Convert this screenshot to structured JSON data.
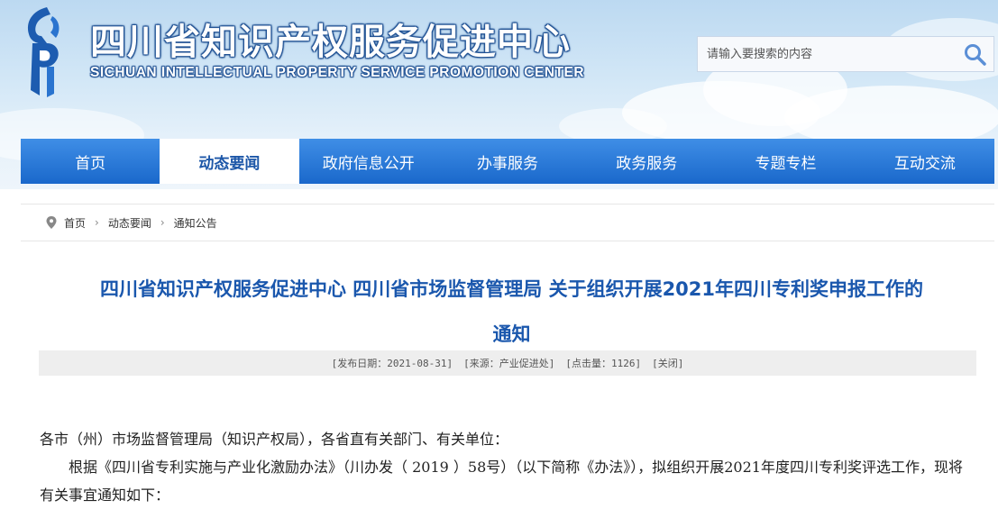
{
  "header": {
    "title": "四川省知识产权服务促进中心",
    "subtitle": "SICHUAN INTELLECTUAL PROPERTY SERVICE PROMOTION CENTER",
    "search": {
      "placeholder": "请输入要搜索的内容",
      "icon": "search-icon"
    }
  },
  "nav": {
    "items": [
      {
        "label": "首页"
      },
      {
        "label": "动态要闻",
        "active": true
      },
      {
        "label": "政府信息公开"
      },
      {
        "label": "办事服务"
      },
      {
        "label": "政务服务"
      },
      {
        "label": "专题专栏"
      },
      {
        "label": "互动交流"
      }
    ]
  },
  "breadcrumb": {
    "icon": "location-pin-icon",
    "items": [
      "首页",
      "动态要闻",
      "通知公告"
    ]
  },
  "article": {
    "title_line1": "四川省知识产权服务促进中心 四川省市场监督管理局 关于组织开展2021年四川专利奖申报工作的",
    "title_line2": "通知",
    "meta": {
      "date": "[发布日期：2021-08-31]",
      "source": "[来源：产业促进处]",
      "views": "[点击量：1126]",
      "close": "[关闭]"
    },
    "paragraphs": [
      "各市（州）市场监督管理局（知识产权局），各省直有关部门、有关单位：",
      "根据《四川省专利实施与产业化激励办法》（川办发（ 2019 ）58号）（以下简称《办法》），拟组织开展2021年度四川专利奖评选工作，现将有关事宜通知如下："
    ]
  },
  "colors": {
    "nav_blue": "#1a68cb",
    "title_blue": "#1a57ad"
  }
}
